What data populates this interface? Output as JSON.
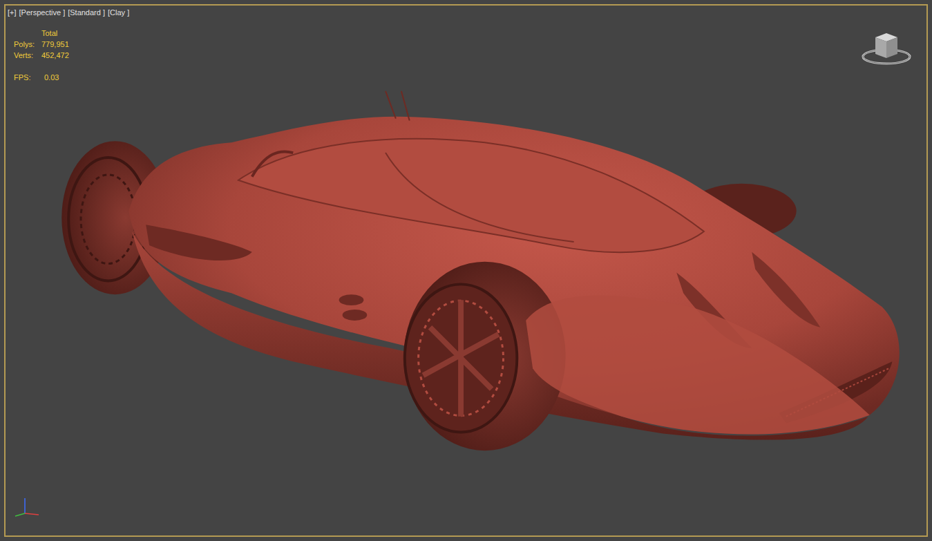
{
  "viewport": {
    "labels": [
      "[+]",
      "[Perspective ]",
      "[Standard ]",
      "[Clay ]"
    ]
  },
  "stats": {
    "header": "Total",
    "rows": [
      {
        "label": "Polys:",
        "value": "779,951"
      },
      {
        "label": "Verts:",
        "value": "452,472"
      }
    ],
    "fps": {
      "label": "FPS:",
      "value": "0.03"
    }
  }
}
